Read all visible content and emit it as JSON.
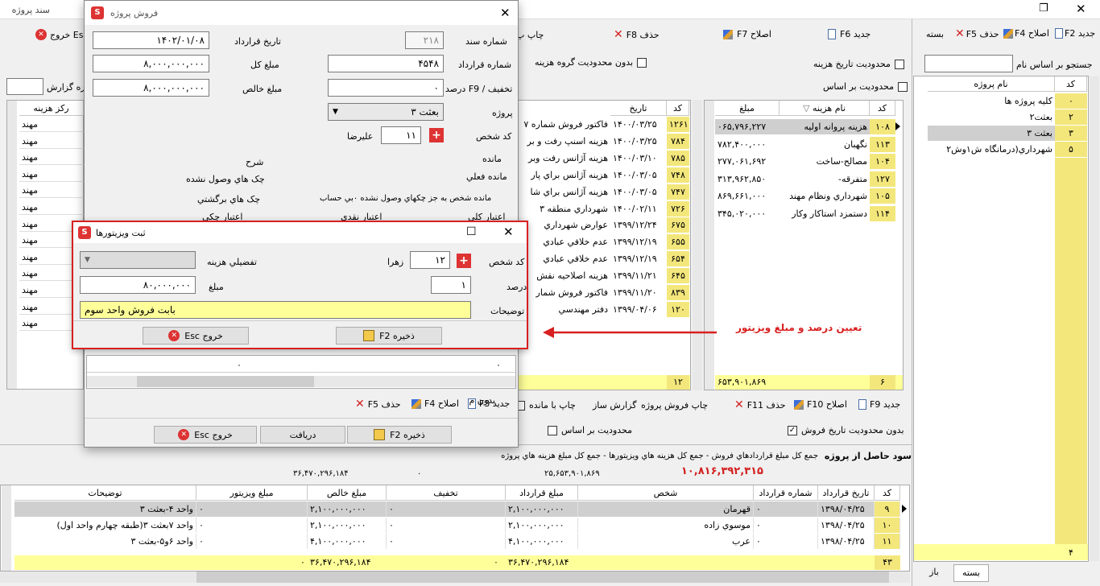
{
  "main": {
    "title": "سند پروژه",
    "toolbar": {
      "new": "جدید F6",
      "edit": "اصلاح F7",
      "del": "حذف F8",
      "print": "چاپ پ",
      "exit": "خروج Esc"
    },
    "limit_group": "بدون محدوديت گروه هزينه",
    "limit_date": "محدوديت تاريخ هزينه",
    "limit_basis": "محدوديت بر اساس",
    "report_label": "اره گزارش",
    "cost_center_col": "ركز هزينه",
    "cost_center_vals": [
      "مهند",
      "مهند",
      "مهند",
      "مهند",
      "مهند",
      "مهند",
      "مهند",
      "مهند",
      "مهند",
      "مهند",
      "مهند",
      "مهند",
      "مهند"
    ],
    "mid_table": {
      "headers": {
        "code": "کد",
        "date": "تاريخ"
      },
      "rows": [
        {
          "code": "۱۲۶۱",
          "date": "۱۴۰۰/۰۳/۲۵",
          "desc": "فاكتور فروش شماره ۷"
        },
        {
          "code": "۷۸۴",
          "date": "۱۴۰۰/۰۳/۲۵",
          "desc": "هزينه اسنپ رفت و بر"
        },
        {
          "code": "۷۸۵",
          "date": "۱۴۰۰/۰۳/۱۰",
          "desc": "هزينه آژانس رفت وبر"
        },
        {
          "code": "۷۴۸",
          "date": "۱۴۰۰/۰۳/۰۵",
          "desc": "هزينه آژانس براي پار"
        },
        {
          "code": "۷۴۷",
          "date": "۱۴۰۰/۰۳/۰۵",
          "desc": "هزينه آژانس براي شا"
        },
        {
          "code": "۷۲۶",
          "date": "۱۴۰۰/۰۲/۱۱",
          "desc": "شهرداري منطقه ۳"
        },
        {
          "code": "۶۷۵",
          "date": "۱۳۹۹/۱۲/۲۴",
          "desc": "عوارض شهرداري"
        },
        {
          "code": "۶۵۵",
          "date": "۱۳۹۹/۱۲/۱۹",
          "desc": "عدم خلافي عبادي"
        },
        {
          "code": "۶۵۴",
          "date": "۱۳۹۹/۱۲/۱۹",
          "desc": "عدم خلافي عبادي"
        },
        {
          "code": "۶۴۵",
          "date": "۱۳۹۹/۱۱/۲۱",
          "desc": "هزينه اصلاحيه نقش"
        },
        {
          "code": "۸۳۹",
          "date": "۱۳۹۹/۱۱/۲۰",
          "desc": "فاكتور فروش شمار"
        },
        {
          "code": "۱۲۰",
          "date": "۱۳۹۹/۰۴/۰۶",
          "desc": "دفتر مهندسي"
        }
      ],
      "footer_code": "۱۲"
    },
    "cost_table": {
      "headers": {
        "code": "کد",
        "name": "نام هزينه",
        "amount": "مبلغ"
      },
      "rows": [
        {
          "code": "۱۰۸",
          "name": "هزينه پروانه اوليه",
          "amount": "۰۶۵,۷۹۶,۲۲۷"
        },
        {
          "code": "۱۱۳",
          "name": "نگهبان",
          "amount": "۷۸۲,۴۰۰,۰۰۰"
        },
        {
          "code": "۱۰۴",
          "name": "مصالح-ساخت",
          "amount": "۲۷۷,۰۶۱,۶۹۲"
        },
        {
          "code": "۱۲۷",
          "name": "متفرقه-",
          "amount": "۳۱۳,۹۶۲,۸۵۰"
        },
        {
          "code": "۱۰۵",
          "name": "شهرداري ونظام مهند",
          "amount": "۸۶۹,۶۶۱,۰۰۰"
        },
        {
          "code": "۱۱۴",
          "name": "دستمزد استاكار وكار",
          "amount": "۳۴۵,۰۲۰,۰۰۰"
        }
      ],
      "footer_code": "۶",
      "footer_amount": "۶۵۳,۹۰۱,۸۶۹"
    },
    "right": {
      "toolbar": {
        "new": "جديد F2",
        "edit": "اصلاح F4",
        "del": "حذف F5",
        "close": "بسته"
      },
      "search_label": "جستجو بر اساس نام",
      "headers": {
        "code": "کد",
        "name": "نام پروژه"
      },
      "rows": [
        {
          "code": "۰",
          "name": "كليه پروژه ها"
        },
        {
          "code": "۲",
          "name": "بعثت۲"
        },
        {
          "code": "۳",
          "name": "بعثت ۳"
        },
        {
          "code": "۵",
          "name": "شهرداري(درمانگاه ش۱وش۲"
        }
      ],
      "footer_count": "۴",
      "tabs": [
        "بسته",
        "باز"
      ]
    },
    "lower_toolbar": {
      "new": "جديد F9",
      "edit": "اصلاح F10",
      "del": "حذف F11",
      "print": "چاپ فروش پروژه",
      "report": "گزارش ساز",
      "print_rest": "چاپ با مانده",
      "without": "بدون م"
    },
    "no_limit_date": "بدون محدوديت تاريخ فروش",
    "limit_basis2": "محدوديت بر اساس",
    "profit": {
      "label": "سود حاصل از پروژه",
      "formula": "جمع كل مبلغ قراردادهاي فروش  -  جمع كل هزينه هاي ويزيتورها  -  جمع كل مبلغ هزينه هاي پروژه",
      "value": "۱۰,۸۱۶,۳۹۲,۳۱۵",
      "v1": "۳۶,۴۷۰,۲۹۶,۱۸۴",
      "v2": "۰",
      "v3": "۲۵,۶۵۳,۹۰۱,۸۶۹"
    },
    "bottom": {
      "headers": [
        "کد",
        "تاريخ قرارداد",
        "شماره قرارداد",
        "شخص",
        "مبلغ قرارداد",
        "تخفيف",
        "مبلغ خالص",
        "مبلغ ويزيتور",
        "توضيحات"
      ],
      "rows": [
        [
          "۹",
          "۱۳۹۸/۰۴/۲۵",
          "۰",
          "قهرمان",
          "۲,۱۰۰,۰۰۰,۰۰۰",
          "۰",
          "۲,۱۰۰,۰۰۰,۰۰۰",
          "۰",
          "واحد ۴-بعثت ۳"
        ],
        [
          "۱۰",
          "۱۳۹۸/۰۴/۲۵",
          "۰",
          "موسوي زاده",
          "۲,۱۰۰,۰۰۰,۰۰۰",
          "۰",
          "۲,۱۰۰,۰۰۰,۰۰۰",
          "۰",
          "واحد ۷بعثت ۳(طبقه چهارم واحد اول)"
        ],
        [
          "۱۱",
          "۱۳۹۸/۰۴/۲۵",
          "۰",
          "عرب",
          "۴,۱۰۰,۰۰۰,۰۰۰",
          "۰",
          "۴,۱۰۰,۰۰۰,۰۰۰",
          "۰",
          "واحد ۶و۵-بعثت ۳"
        ]
      ],
      "footer": {
        "code": "۴۳",
        "contract": "۳۶,۴۷۰,۲۹۶,۱۸۴",
        "disc": "۰",
        "net": "۳۶,۴۷۰,۲۹۶,۱۸۴",
        "visitor": "۰"
      }
    }
  },
  "sale": {
    "title": "فروش پروژه",
    "doc_no_label": "شماره سند",
    "doc_no": "۲۱۸",
    "contract_date_label": "تاريخ قرارداد",
    "contract_date": "۱۴۰۲/۰۱/۰۸",
    "contract_no_label": "شماره قرارداد",
    "contract_no": "۴۵۴۸",
    "total_label": "مبلغ كل",
    "total": "۸,۰۰۰,۰۰۰,۰۰۰",
    "disc_label": "تخفيف / F9 درصد",
    "disc": "۰",
    "net_label": "مبلغ خالص",
    "net": "۸,۰۰۰,۰۰۰,۰۰۰",
    "project_label": "پروژه",
    "project": "بعثت ۳",
    "person_label": "کد شخص",
    "person_code": "۱۱",
    "person_name": "عليرضا",
    "remain_label": "مانده",
    "desc_label": "شرح",
    "cur_remain_label": "مانده فعلي",
    "cheques_label": "چک هاي وصول نشده",
    "remain_text": "مانده شخص به جز چكهاي وصول نشده ۰بي حساب",
    "returned_label": "چک هاي برگشتي",
    "total_credit": "اعتبار کلي",
    "cash_credit": "اعتبار نقدي",
    "cheque_credit": "اعتبار چكي",
    "tb": {
      "new": "جديد F3",
      "edit": "اصلاح F4",
      "del": "حذف F5"
    },
    "grid_zero1": "۰",
    "grid_zero2": "۰",
    "save": "ذخيره F2",
    "receive": "دريافت",
    "exit": "خروج Esc"
  },
  "visitor": {
    "title": "ثبت ويزيتورها",
    "person_label": "کد شخص",
    "person_code": "۱۲",
    "person_name": "زهرا",
    "detail_label": "تفضيلي هزينه",
    "percent_label": "درصد",
    "percent": "۱",
    "amount_label": "مبلغ",
    "amount": "۸۰,۰۰۰,۰۰۰",
    "notes_label": "توضيحات",
    "notes": "بابت فروش واحد سوم",
    "save": "ذخيره F2",
    "exit": "خروج Esc"
  },
  "annotation": "تعيين درصد و مبلغ ويزيتور",
  "colors": {
    "yellow": "#f3e77c",
    "accent": "#d32020"
  }
}
